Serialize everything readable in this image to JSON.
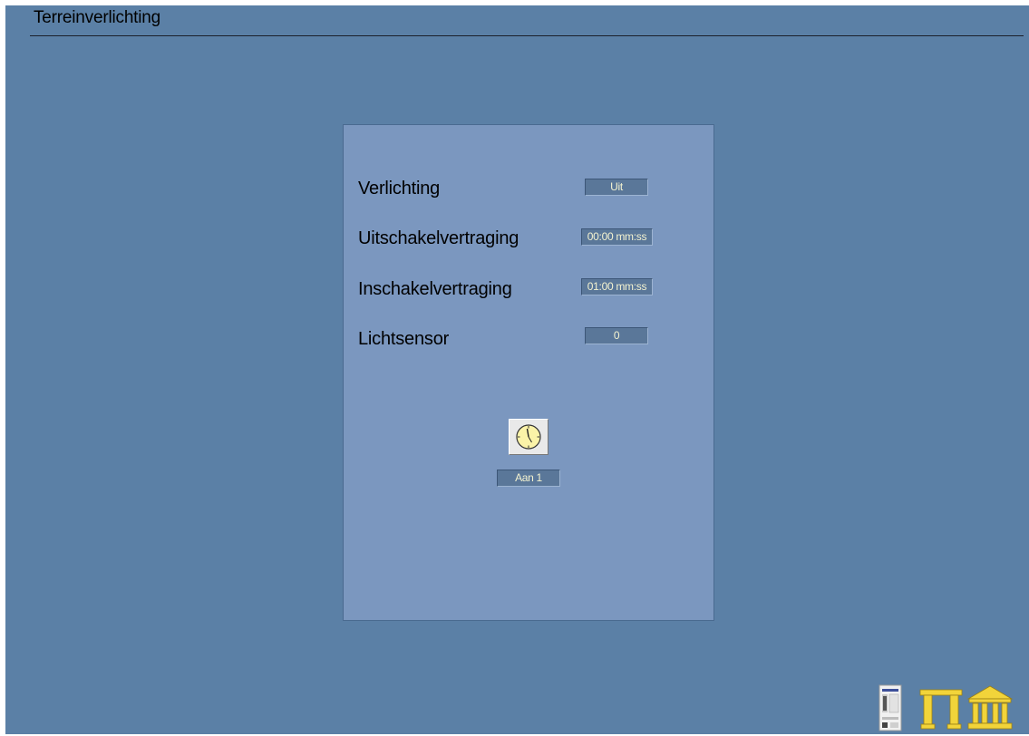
{
  "window": {
    "title": "Terreinverlichting"
  },
  "panel": {
    "rows": [
      {
        "label": "Verlichting",
        "value": "Uit"
      },
      {
        "label": "Uitschakelvertraging",
        "value": "00:00 mm:ss"
      },
      {
        "label": "Inschakelvertraging",
        "value": "01:00 mm:ss"
      },
      {
        "label": "Lichtsensor",
        "value": "0"
      }
    ],
    "schedule": {
      "icon": "clock-icon",
      "status": "Aan 1"
    }
  },
  "footer": {
    "icons": [
      "controller-device-icon",
      "gate-icon",
      "building-icon"
    ]
  },
  "colors": {
    "background": "#5b80a6",
    "panel": "#7b97bf",
    "value_box": "#5a7799",
    "value_text": "#f4f3d0",
    "icon_gold": "#f2d43a"
  }
}
